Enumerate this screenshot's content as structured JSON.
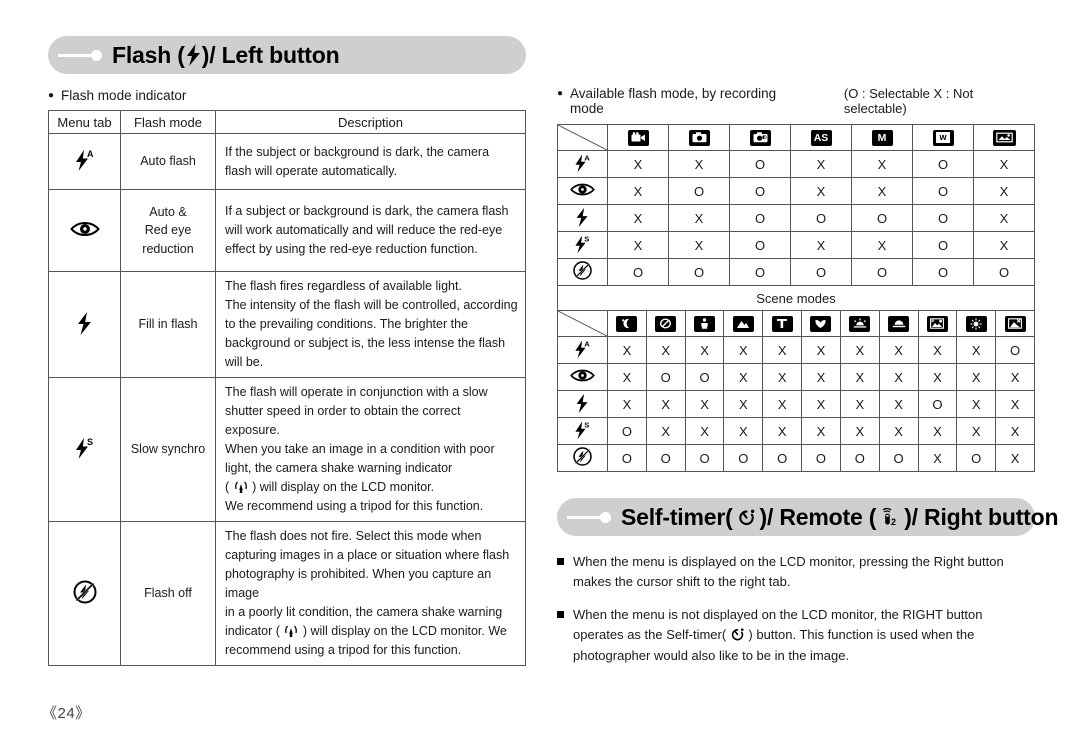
{
  "page_number": "《24》",
  "left": {
    "banner": {
      "title_before": "Flash (",
      "icon": "flash-bolt-icon",
      "title_after": ")/ Left button"
    },
    "bullet": "Flash mode indicator",
    "table": {
      "headers": [
        "Menu tab",
        "Flash mode",
        "Description"
      ],
      "rows": [
        {
          "icon": "flash-auto-icon",
          "mode": "Auto flash",
          "description": "If the subject or background is dark, the camera flash will operate automatically."
        },
        {
          "icon": "red-eye-icon",
          "mode": "Auto &\nRed eye\nreduction",
          "description": "If a subject or background is dark, the camera flash will work automatically and will reduce the red-eye effect by using the red-eye reduction function."
        },
        {
          "icon": "flash-fill-icon",
          "mode": "Fill in flash",
          "description": "The flash fires regardless of available light.\nThe intensity of the flash will be controlled, according to the prevailing conditions. The brighter the background or subject is, the less intense the flash will be."
        },
        {
          "icon": "flash-slow-sync-icon",
          "mode": "Slow synchro",
          "description_lines": [
            "The flash will operate in conjunction with a slow",
            "shutter speed in order to obtain the correct exposure.",
            "When you take an image in a condition with poor",
            "light, the camera shake warning indicator",
            "( @SHAKE@ ) will display on the LCD monitor.",
            "We recommend using a tripod for this function."
          ]
        },
        {
          "icon": "flash-off-icon",
          "mode": "Flash off",
          "description_lines": [
            "The flash does not fire. Select this mode when",
            "capturing images in a place or situation where flash",
            "photography is prohibited. When you capture an image",
            "in a poorly lit condition, the camera shake warning",
            "indicator ( @SHAKE@ ) will display on the LCD monitor. We",
            "recommend using a tripod for this function."
          ]
        }
      ]
    }
  },
  "right": {
    "bullet": "Available flash mode, by recording mode",
    "legend": "(O : Selectable X : Not selectable)",
    "recording_table": {
      "column_icons": [
        "movie-clip-icon",
        "auto-camera-icon",
        "program-camera-icon",
        "as-mode-icon",
        "manual-mode-icon",
        "w-mode-icon",
        "scene-mode-icon"
      ],
      "column_labels": [
        "",
        "",
        "",
        "AS",
        "M",
        "w",
        ""
      ],
      "row_icons": [
        "flash-auto-icon",
        "red-eye-icon",
        "flash-fill-icon",
        "flash-slow-sync-icon",
        "flash-off-icon"
      ],
      "values": [
        [
          "X",
          "X",
          "O",
          "X",
          "X",
          "O",
          "X"
        ],
        [
          "X",
          "O",
          "O",
          "X",
          "X",
          "O",
          "X"
        ],
        [
          "X",
          "X",
          "O",
          "O",
          "O",
          "O",
          "X"
        ],
        [
          "X",
          "X",
          "O",
          "X",
          "X",
          "O",
          "X"
        ],
        [
          "O",
          "O",
          "O",
          "O",
          "O",
          "O",
          "O"
        ]
      ]
    },
    "scene_table": {
      "title": "Scene modes",
      "column_icons": [
        "night-icon",
        "portrait-icon",
        "children-icon",
        "landscape-icon",
        "text-icon",
        "close-up-icon",
        "sunset-icon",
        "dawn-icon",
        "backlight-icon",
        "fireworks-icon",
        "beach-snow-icon"
      ],
      "row_icons": [
        "flash-auto-icon",
        "red-eye-icon",
        "flash-fill-icon",
        "flash-slow-sync-icon",
        "flash-off-icon"
      ],
      "values": [
        [
          "X",
          "X",
          "X",
          "X",
          "X",
          "X",
          "X",
          "X",
          "X",
          "X",
          "O"
        ],
        [
          "X",
          "O",
          "O",
          "X",
          "X",
          "X",
          "X",
          "X",
          "X",
          "X",
          "X"
        ],
        [
          "X",
          "X",
          "X",
          "X",
          "X",
          "X",
          "X",
          "X",
          "O",
          "X",
          "X"
        ],
        [
          "O",
          "X",
          "X",
          "X",
          "X",
          "X",
          "X",
          "X",
          "X",
          "X",
          "X"
        ],
        [
          "O",
          "O",
          "O",
          "O",
          "O",
          "O",
          "O",
          "O",
          "X",
          "O",
          "X"
        ]
      ]
    },
    "banner": {
      "title_a": "Self-timer(",
      "icon_a": "self-timer-icon",
      "title_b": ")/ Remote (",
      "icon_b": "remote-icon",
      "title_c": ")/ Right button"
    },
    "notes": [
      "When the menu is displayed on the LCD monitor, pressing the Right button makes the cursor shift to the right tab.",
      "When the menu is not displayed on the LCD monitor, the RIGHT button operates as the Self-timer( @TIMER@ ) button. This function is used when the photographer would also like to be in the image."
    ]
  }
}
